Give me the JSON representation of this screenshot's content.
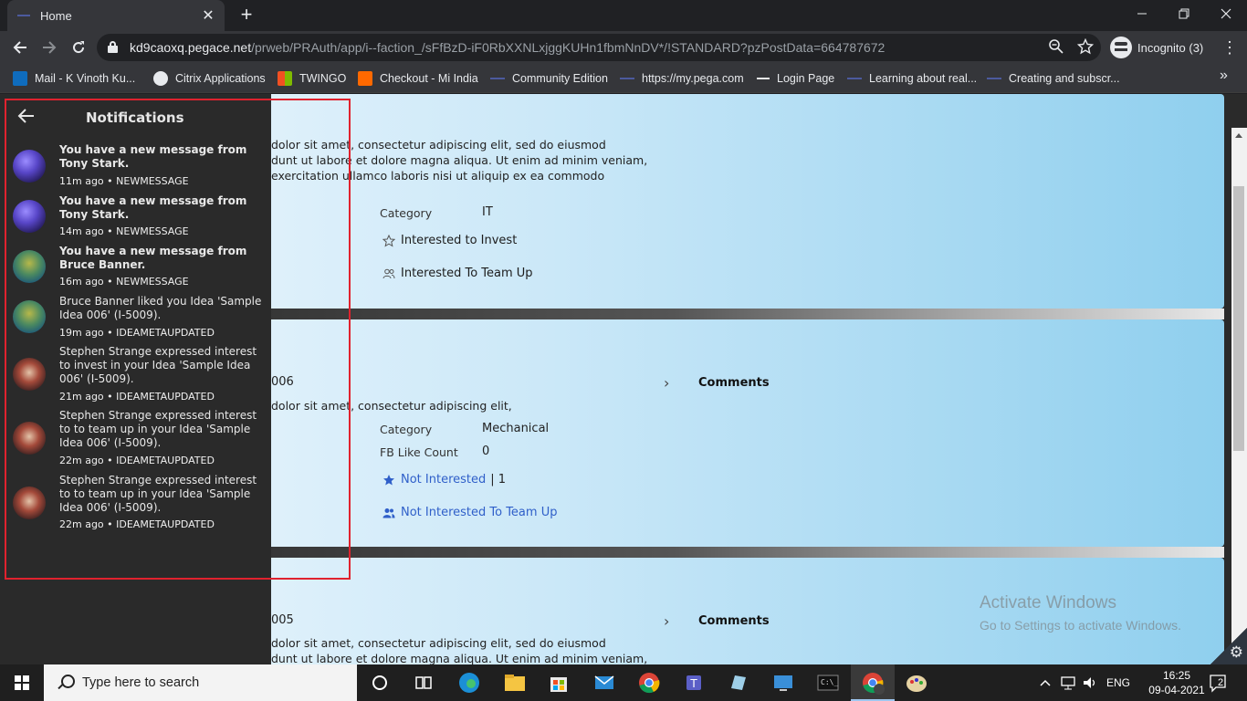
{
  "browser": {
    "tab_title": "Home",
    "tab_close": "✕",
    "new_tab": "+",
    "url_host": "kd9caoxq.pegace.net",
    "url_path": "/prweb/PRAuth/app/i--faction_/sFfBzD-iF0RbXXNLxjggKUHn1fbmNnDV*/!STANDARD?pzPostData=664787672",
    "profile_label": "Incognito (3)",
    "bookmarks": [
      {
        "label": "Mail - K Vinoth Ku...",
        "icon": "outlook-icon",
        "color": "#0f6cbd"
      },
      {
        "label": "Citrix Applications",
        "icon": "citrix-icon",
        "color": "#e8eaed"
      },
      {
        "label": "TWINGO",
        "icon": "microsoft-icon",
        "color": "#f25022"
      },
      {
        "label": "Checkout - Mi India",
        "icon": "mi-icon",
        "color": "#ff6900"
      },
      {
        "label": "Community Edition",
        "icon": "pega-icon",
        "color": "#4c5a9e"
      },
      {
        "label": "https://my.pega.com",
        "icon": "pega-icon",
        "color": "#4c5a9e"
      },
      {
        "label": "Login Page",
        "icon": "login-icon",
        "color": "#e8eaed"
      },
      {
        "label": "Learning about real...",
        "icon": "pega-icon",
        "color": "#4c5a9e"
      },
      {
        "label": "Creating and subscr...",
        "icon": "pega-icon",
        "color": "#4c5a9e"
      }
    ],
    "bookmarks_more": "»"
  },
  "notifications": {
    "title": "Notifications",
    "items": [
      {
        "message": "You have a new message from Tony Stark.",
        "meta": "11m ago  • NEWMESSAGE",
        "avatar": "purple",
        "bold": true
      },
      {
        "message": "You have a new message from Tony Stark.",
        "meta": "14m ago  • NEWMESSAGE",
        "avatar": "purple",
        "bold": true
      },
      {
        "message": "You have a new message from Bruce Banner.",
        "meta": "16m ago  • NEWMESSAGE",
        "avatar": "green",
        "bold": true
      },
      {
        "message": "Bruce Banner liked you Idea 'Sample Idea 006' (I-5009).",
        "meta": "19m ago  • IDEAMETAUPDATED",
        "avatar": "green",
        "bold": false
      },
      {
        "message": "Stephen Strange expressed interest to invest in your Idea 'Sample Idea 006' (I-5009).",
        "meta": "21m ago  • IDEAMETAUPDATED",
        "avatar": "red",
        "bold": false
      },
      {
        "message": "Stephen Strange expressed interest to to team up in your Idea 'Sample Idea 006' (I-5009).",
        "meta": "22m ago  • IDEAMETAUPDATED",
        "avatar": "red",
        "bold": false
      },
      {
        "message": "Stephen Strange expressed interest to to team up in your Idea 'Sample Idea 006' (I-5009).",
        "meta": "22m ago  • IDEAMETAUPDATED",
        "avatar": "red",
        "bold": false
      }
    ]
  },
  "cards": [
    {
      "desc_lines": [
        "dolor sit amet, consectetur adipiscing elit, sed do eiusmod",
        "dunt ut labore et dolore magna aliqua. Ut enim ad minim veniam,",
        "exercitation ullamco laboris nisi ut aliquip ex ea commodo"
      ],
      "category_label": "Category",
      "category_value": "IT",
      "invest_label": "Interested to Invest",
      "teamup_label": "Interested To Team Up"
    },
    {
      "id_suffix": "006",
      "desc_lines": [
        "dolor sit amet, consectetur adipiscing elit,"
      ],
      "category_label": "Category",
      "category_value": "Mechanical",
      "fb_label": "FB Like Count",
      "fb_value": "0",
      "invest_label": "Not Interested",
      "invest_count": "| 1",
      "teamup_label": "Not Interested To Team Up",
      "comments_label": "Comments"
    },
    {
      "id_suffix": "005",
      "desc_lines": [
        "dolor sit amet, consectetur adipiscing elit, sed do eiusmod",
        "dunt ut labore et dolore magna aliqua. Ut enim ad minim veniam,"
      ],
      "comments_label": "Comments"
    }
  ],
  "watermark": {
    "line1": "Activate Windows",
    "line2": "Go to Settings to activate Windows."
  },
  "taskbar": {
    "search_placeholder": "Type here to search",
    "language": "ENG",
    "time": "16:25",
    "date": "09-04-2021",
    "notification_count": "2"
  },
  "colors": {
    "highlight_border": "#e0222e",
    "link": "#2f5fc9"
  }
}
